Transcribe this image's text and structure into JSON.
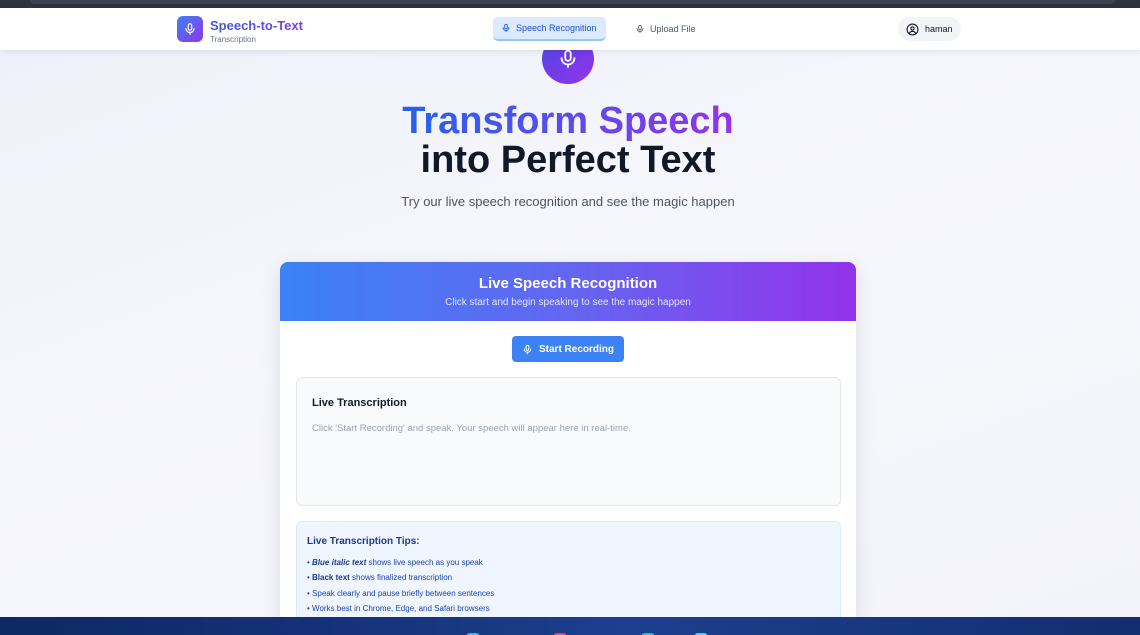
{
  "app": {
    "brand_title": "Speech-to-Text",
    "brand_subtitle": "Transcription"
  },
  "nav": {
    "tabs": [
      {
        "label": "Speech Recognition",
        "active": true
      },
      {
        "label": "Upload File",
        "active": false
      }
    ],
    "user": "haman"
  },
  "hero": {
    "line1": "Transform Speech",
    "line2": "into Perfect Text",
    "subtitle": "Try our live speech recognition and see the magic happen"
  },
  "card": {
    "title": "Live Speech Recognition",
    "subtitle": "Click start and begin speaking to see the magic happen",
    "record_button": "Start Recording",
    "transcription_title": "Live Transcription",
    "transcription_placeholder": "Click 'Start Recording' and speak. Your speech will appear here in real-time."
  },
  "tips": {
    "title": "Live Transcription Tips:",
    "items": [
      {
        "prefix": "• ",
        "strong": "Blue italic text",
        "rest": " shows live speech as you speak"
      },
      {
        "prefix": "• ",
        "strong": "Black text",
        "rest": " shows finalized transcription"
      },
      {
        "prefix": "• ",
        "strong": "",
        "rest": "Speak clearly and pause briefly between sentences"
      },
      {
        "prefix": "• ",
        "strong": "",
        "rest": "Works best in Chrome, Edge, and Safari browsers"
      }
    ]
  },
  "colors": {
    "accent_blue": "#3b82f6",
    "accent_purple": "#9333ea",
    "tips_bg": "#eff6ff"
  },
  "icons": {
    "logo": "microphone-icon",
    "nav_speech": "microphone-icon",
    "nav_upload": "microphone-icon",
    "user": "user-circle-icon",
    "hero": "microphone-icon",
    "record": "microphone-icon"
  }
}
